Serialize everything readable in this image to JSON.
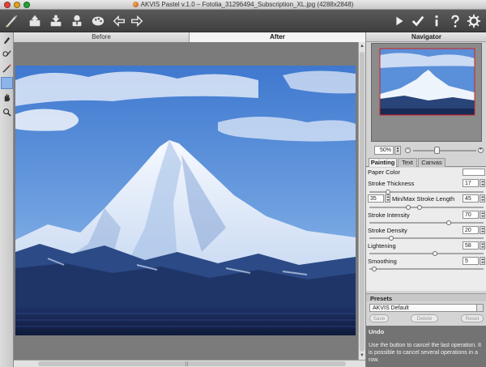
{
  "window": {
    "title": "AKVIS Pastel v.1.0 – Fotolia_31296494_Subscription_XL.jpg (4288x2848)"
  },
  "toolbar": {
    "left_icons": [
      "pastel-logo-icon",
      "open-file-icon",
      "save-file-icon",
      "share-icon",
      "preferences-palette-icon",
      "undo-arrow-icon",
      "redo-arrow-icon"
    ],
    "right_icons": [
      "run-play-icon",
      "apply-check-icon",
      "info-icon",
      "help-icon",
      "settings-gear-icon"
    ]
  },
  "tools": [
    "pastel-brush-icon",
    "stroke-direction-icon",
    "eraser-icon",
    "selection-tool-icon",
    "hand-icon",
    "zoom-icon"
  ],
  "view_tabs": {
    "before": "Before",
    "after": "After",
    "active": "After"
  },
  "navigator": {
    "title": "Navigator",
    "zoom": "50%"
  },
  "settings_tabs": {
    "painting": "Painting",
    "text": "Text",
    "canvas": "Canvas",
    "active": "Painting"
  },
  "params": {
    "paper_color": {
      "label": "Paper Color",
      "color": "#ffffff"
    },
    "stroke_thickness": {
      "label": "Stroke Thickness",
      "value": "17",
      "slider": 0.17
    },
    "stroke_length": {
      "label": "Min/Max Stroke Length",
      "min": "35",
      "max": "45",
      "slider_min": 0.35,
      "slider_max": 0.45
    },
    "stroke_intensity": {
      "label": "Stroke Intensity",
      "value": "70",
      "slider": 0.7
    },
    "stroke_density": {
      "label": "Stroke Density",
      "value": "20",
      "slider": 0.2
    },
    "lightening": {
      "label": "Lightening",
      "value": "58",
      "slider": 0.58
    },
    "smoothing": {
      "label": "Smoothing",
      "value": "5",
      "slider": 0.05
    }
  },
  "presets": {
    "title": "Presets",
    "selected": "AKVIS Default",
    "save": "Save",
    "delete": "Delete",
    "reset": "Reset"
  },
  "help": {
    "title": "Undo",
    "text": "Use the button to cancel the last operation. It is possible to cancel several operations in a row."
  },
  "colors": {
    "sky": "#4f88d6",
    "mountain_snow": "#e9f1fb",
    "mountain_shadow": "#2c4a86",
    "water": "#1c2c58"
  }
}
